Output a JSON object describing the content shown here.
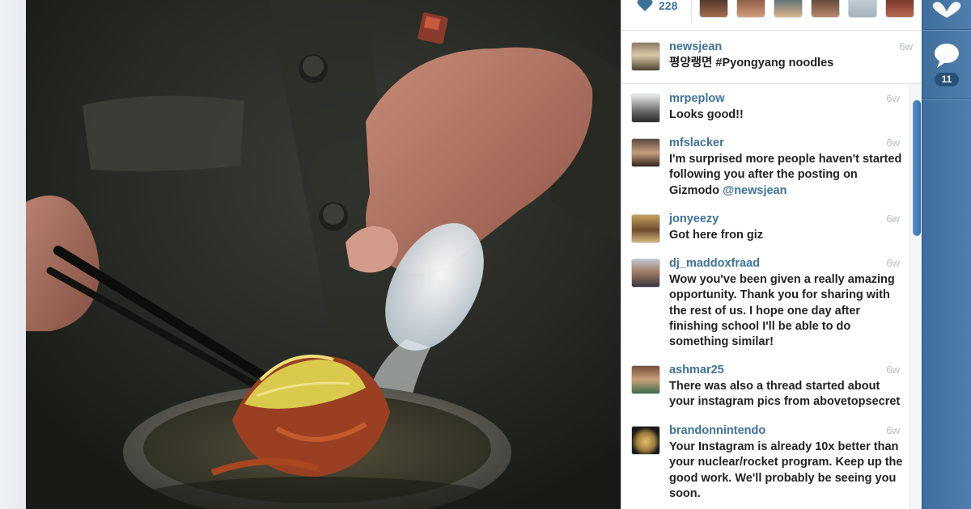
{
  "likes": {
    "count": "228"
  },
  "caption": {
    "username": "newsjean",
    "time": "6w",
    "text": "평양랭면 #Pyongyang noodles"
  },
  "comments": [
    {
      "username": "mrpeplow",
      "time": "6w",
      "text": "Looks good!!"
    },
    {
      "username": "mfslacker",
      "time": "6w",
      "text": "I'm surprised more people haven't started following you after the posting on Gizmodo ",
      "mention": "@newsjean"
    },
    {
      "username": "jonyeezy",
      "time": "6w",
      "text": "Got here fron giz"
    },
    {
      "username": "dj_maddoxfraad",
      "time": "6w",
      "text": "Wow you've been given a really amazing opportunity. Thank you for sharing with the rest of us. I hope one day after finishing school I'll be able to do something similar!"
    },
    {
      "username": "ashmar25",
      "time": "6w",
      "text": "There was also a thread started about your instagram pics from abovetopsecret"
    },
    {
      "username": "brandonnintendo",
      "time": "6w",
      "text": "Your Instagram is already 10x better than your nuclear/rocket program. Keep up the good work. We'll probably be seeing you soon."
    }
  ],
  "rail": {
    "comment_count": "11"
  },
  "colors": {
    "link": "#3f729b",
    "rail": "#4a79a8",
    "scroll": "#3a78b8"
  }
}
